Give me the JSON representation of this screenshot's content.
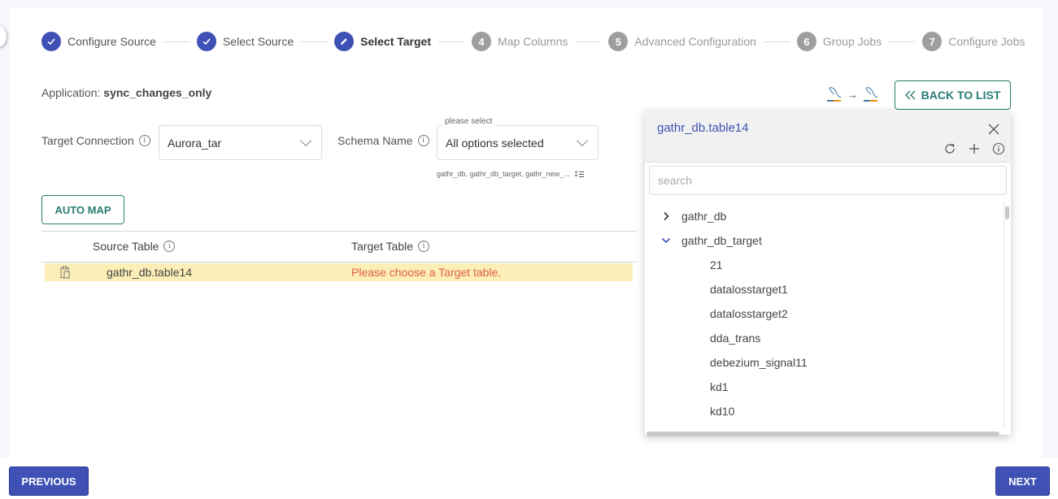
{
  "stepper": {
    "steps": [
      {
        "number": "1",
        "label": "Configure Source",
        "state": "done"
      },
      {
        "number": "2",
        "label": "Select Source",
        "state": "done"
      },
      {
        "number": "3",
        "label": "Select Target",
        "state": "active"
      },
      {
        "number": "4",
        "label": "Map Columns",
        "state": "pending"
      },
      {
        "number": "5",
        "label": "Advanced Configuration",
        "state": "pending"
      },
      {
        "number": "6",
        "label": "Group Jobs",
        "state": "pending"
      },
      {
        "number": "7",
        "label": "Configure Jobs",
        "state": "pending"
      }
    ]
  },
  "application": {
    "label": "Application:",
    "name": "sync_changes_only"
  },
  "header": {
    "source_db_icon": "mysql-logo-icon",
    "target_db_icon": "mysql-logo-icon",
    "arrow": "→",
    "back_label": "BACK TO LIST"
  },
  "form": {
    "target_connection": {
      "label": "Target Connection",
      "value": "Aurora_tar"
    },
    "schema_name": {
      "label": "Schema Name",
      "float_label": "please select",
      "value": "All options selected",
      "selected_summary": "gathr_db, gathr_db_target, gathr_new_..."
    }
  },
  "auto_map_label": "AUTO MAP",
  "table": {
    "columns": [
      "Source Table",
      "Target Table"
    ],
    "rows": [
      {
        "source": "gathr_db.table14",
        "target": "Please choose a Target table."
      }
    ]
  },
  "panel": {
    "title": "gathr_db.table14",
    "search_placeholder": "search",
    "search_value": "",
    "tree": [
      {
        "label": "gathr_db",
        "level": 0,
        "expanded": false
      },
      {
        "label": "gathr_db_target",
        "level": 0,
        "expanded": true
      },
      {
        "label": "21",
        "level": 1
      },
      {
        "label": "datalosstarget1",
        "level": 1
      },
      {
        "label": "datalosstarget2",
        "level": 1
      },
      {
        "label": "dda_trans",
        "level": 1
      },
      {
        "label": "debezium_signal11",
        "level": 1
      },
      {
        "label": "kd1",
        "level": 1
      },
      {
        "label": "kd10",
        "level": 1
      }
    ]
  },
  "footer": {
    "previous_label": "PREVIOUS",
    "next_label": "NEXT"
  },
  "colors": {
    "primary": "#3f51b5",
    "teal": "#287d72",
    "error": "#e35d47",
    "row_highlight": "#fbeeb6"
  }
}
